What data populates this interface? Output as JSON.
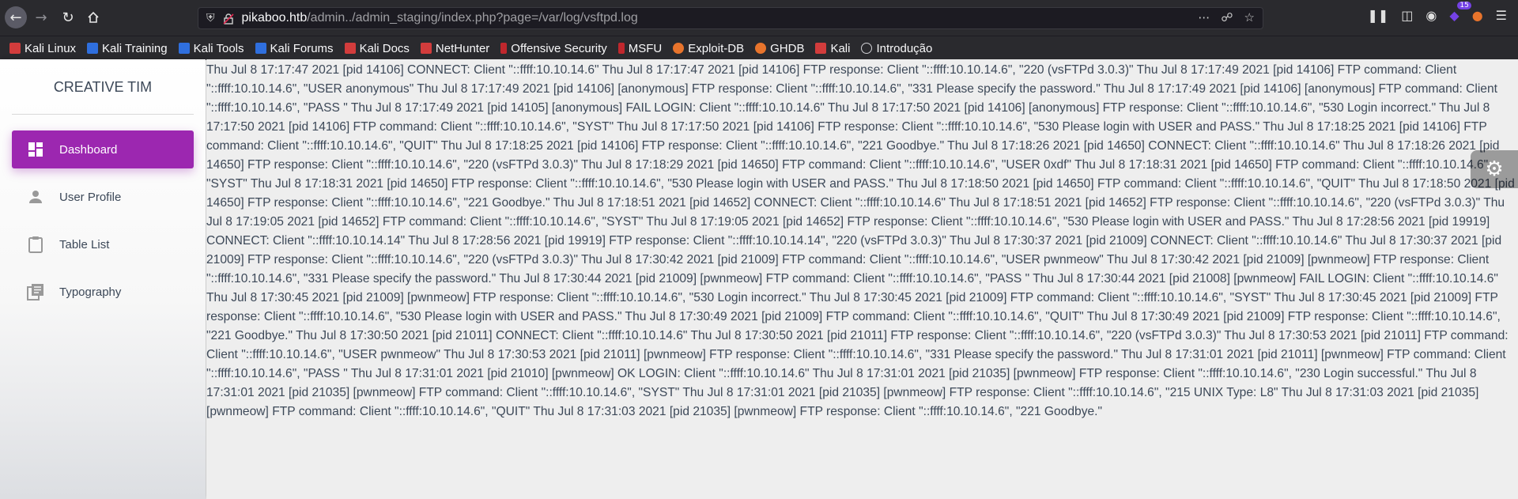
{
  "browser": {
    "url_host": "pikaboo.htb",
    "url_path": "/admin../admin_staging/index.php?page=/var/log/vsftpd.log",
    "library_badge": "15",
    "bookmarks": [
      {
        "label": "Kali Linux",
        "icon": "kali-icon",
        "color": "#d23c3c"
      },
      {
        "label": "Kali Training",
        "icon": "kali-training-icon",
        "color": "#2f6fde"
      },
      {
        "label": "Kali Tools",
        "icon": "kali-tools-icon",
        "color": "#2f6fde"
      },
      {
        "label": "Kali Forums",
        "icon": "kali-forums-icon",
        "color": "#2f6fde"
      },
      {
        "label": "Kali Docs",
        "icon": "kali-docs-icon",
        "color": "#d23c3c"
      },
      {
        "label": "NetHunter",
        "icon": "nethunter-icon",
        "color": "#d23c3c"
      },
      {
        "label": "Offensive Security",
        "icon": "offsec-icon",
        "color": "#c0272d"
      },
      {
        "label": "MSFU",
        "icon": "msfu-icon",
        "color": "#c0272d"
      },
      {
        "label": "Exploit-DB",
        "icon": "exploitdb-icon",
        "color": "#e8742c"
      },
      {
        "label": "GHDB",
        "icon": "ghdb-icon",
        "color": "#e8742c"
      },
      {
        "label": "Kali",
        "icon": "kali-icon",
        "color": "#d23c3c"
      },
      {
        "label": "Introdução",
        "icon": "globe-icon",
        "color": "#cfcfd4"
      }
    ]
  },
  "sidebar": {
    "logo": "CREATIVE TIM",
    "accent": "#9c27b0",
    "items": [
      {
        "label": "Dashboard",
        "icon": "dashboard-icon",
        "active": true
      },
      {
        "label": "User Profile",
        "icon": "person-icon",
        "active": false
      },
      {
        "label": "Table List",
        "icon": "clipboard-icon",
        "active": false
      },
      {
        "label": "Typography",
        "icon": "library-books-icon",
        "active": false
      }
    ]
  },
  "main": {
    "log_text": "Thu Jul 8 17:17:47 2021 [pid 14106] CONNECT: Client \"::ffff:10.10.14.6\" Thu Jul 8 17:17:47 2021 [pid 14106] FTP response: Client \"::ffff:10.10.14.6\", \"220 (vsFTPd 3.0.3)\" Thu Jul 8 17:17:49 2021 [pid 14106] FTP command: Client \"::ffff:10.10.14.6\", \"USER anonymous\" Thu Jul 8 17:17:49 2021 [pid 14106] [anonymous] FTP response: Client \"::ffff:10.10.14.6\", \"331 Please specify the password.\" Thu Jul 8 17:17:49 2021 [pid 14106] [anonymous] FTP command: Client \"::ffff:10.10.14.6\", \"PASS \" Thu Jul 8 17:17:49 2021 [pid 14105] [anonymous] FAIL LOGIN: Client \"::ffff:10.10.14.6\" Thu Jul 8 17:17:50 2021 [pid 14106] [anonymous] FTP response: Client \"::ffff:10.10.14.6\", \"530 Login incorrect.\" Thu Jul 8 17:17:50 2021 [pid 14106] FTP command: Client \"::ffff:10.10.14.6\", \"SYST\" Thu Jul 8 17:17:50 2021 [pid 14106] FTP response: Client \"::ffff:10.10.14.6\", \"530 Please login with USER and PASS.\" Thu Jul 8 17:18:25 2021 [pid 14106] FTP command: Client \"::ffff:10.10.14.6\", \"QUIT\" Thu Jul 8 17:18:25 2021 [pid 14106] FTP response: Client \"::ffff:10.10.14.6\", \"221 Goodbye.\" Thu Jul 8 17:18:26 2021 [pid 14650] CONNECT: Client \"::ffff:10.10.14.6\" Thu Jul 8 17:18:26 2021 [pid 14650] FTP response: Client \"::ffff:10.10.14.6\", \"220 (vsFTPd 3.0.3)\" Thu Jul 8 17:18:29 2021 [pid 14650] FTP command: Client \"::ffff:10.10.14.6\", \"USER 0xdf\" Thu Jul 8 17:18:31 2021 [pid 14650] FTP command: Client \"::ffff:10.10.14.6\", \"SYST\" Thu Jul 8 17:18:31 2021 [pid 14650] FTP response: Client \"::ffff:10.10.14.6\", \"530 Please login with USER and PASS.\" Thu Jul 8 17:18:50 2021 [pid 14650] FTP command: Client \"::ffff:10.10.14.6\", \"QUIT\" Thu Jul 8 17:18:50 2021 [pid 14650] FTP response: Client \"::ffff:10.10.14.6\", \"221 Goodbye.\" Thu Jul 8 17:18:51 2021 [pid 14652] CONNECT: Client \"::ffff:10.10.14.6\" Thu Jul 8 17:18:51 2021 [pid 14652] FTP response: Client \"::ffff:10.10.14.6\", \"220 (vsFTPd 3.0.3)\" Thu Jul 8 17:19:05 2021 [pid 14652] FTP command: Client \"::ffff:10.10.14.6\", \"SYST\" Thu Jul 8 17:19:05 2021 [pid 14652] FTP response: Client \"::ffff:10.10.14.6\", \"530 Please login with USER and PASS.\" Thu Jul 8 17:28:56 2021 [pid 19919] CONNECT: Client \"::ffff:10.10.14.14\" Thu Jul 8 17:28:56 2021 [pid 19919] FTP response: Client \"::ffff:10.10.14.14\", \"220 (vsFTPd 3.0.3)\" Thu Jul 8 17:30:37 2021 [pid 21009] CONNECT: Client \"::ffff:10.10.14.6\" Thu Jul 8 17:30:37 2021 [pid 21009] FTP response: Client \"::ffff:10.10.14.6\", \"220 (vsFTPd 3.0.3)\" Thu Jul 8 17:30:42 2021 [pid 21009] FTP command: Client \"::ffff:10.10.14.6\", \"USER pwnmeow\" Thu Jul 8 17:30:42 2021 [pid 21009] [pwnmeow] FTP response: Client \"::ffff:10.10.14.6\", \"331 Please specify the password.\" Thu Jul 8 17:30:44 2021 [pid 21009] [pwnmeow] FTP command: Client \"::ffff:10.10.14.6\", \"PASS \" Thu Jul 8 17:30:44 2021 [pid 21008] [pwnmeow] FAIL LOGIN: Client \"::ffff:10.10.14.6\" Thu Jul 8 17:30:45 2021 [pid 21009] [pwnmeow] FTP response: Client \"::ffff:10.10.14.6\", \"530 Login incorrect.\" Thu Jul 8 17:30:45 2021 [pid 21009] FTP command: Client \"::ffff:10.10.14.6\", \"SYST\" Thu Jul 8 17:30:45 2021 [pid 21009] FTP response: Client \"::ffff:10.10.14.6\", \"530 Please login with USER and PASS.\" Thu Jul 8 17:30:49 2021 [pid 21009] FTP command: Client \"::ffff:10.10.14.6\", \"QUIT\" Thu Jul 8 17:30:49 2021 [pid 21009] FTP response: Client \"::ffff:10.10.14.6\", \"221 Goodbye.\" Thu Jul 8 17:30:50 2021 [pid 21011] CONNECT: Client \"::ffff:10.10.14.6\" Thu Jul 8 17:30:50 2021 [pid 21011] FTP response: Client \"::ffff:10.10.14.6\", \"220 (vsFTPd 3.0.3)\" Thu Jul 8 17:30:53 2021 [pid 21011] FTP command: Client \"::ffff:10.10.14.6\", \"USER pwnmeow\" Thu Jul 8 17:30:53 2021 [pid 21011] [pwnmeow] FTP response: Client \"::ffff:10.10.14.6\", \"331 Please specify the password.\" Thu Jul 8 17:31:01 2021 [pid 21011] [pwnmeow] FTP command: Client \"::ffff:10.10.14.6\", \"PASS \" Thu Jul 8 17:31:01 2021 [pid 21010] [pwnmeow] OK LOGIN: Client \"::ffff:10.10.14.6\" Thu Jul 8 17:31:01 2021 [pid 21035] [pwnmeow] FTP response: Client \"::ffff:10.10.14.6\", \"230 Login successful.\" Thu Jul 8 17:31:01 2021 [pid 21035] [pwnmeow] FTP command: Client \"::ffff:10.10.14.6\", \"SYST\" Thu Jul 8 17:31:01 2021 [pid 21035] [pwnmeow] FTP response: Client \"::ffff:10.10.14.6\", \"215 UNIX Type: L8\" Thu Jul 8 17:31:03 2021 [pid 21035] [pwnmeow] FTP command: Client \"::ffff:10.10.14.6\", \"QUIT\" Thu Jul 8 17:31:03 2021 [pid 21035] [pwnmeow] FTP response: Client \"::ffff:10.10.14.6\", \"221 Goodbye.\""
  }
}
